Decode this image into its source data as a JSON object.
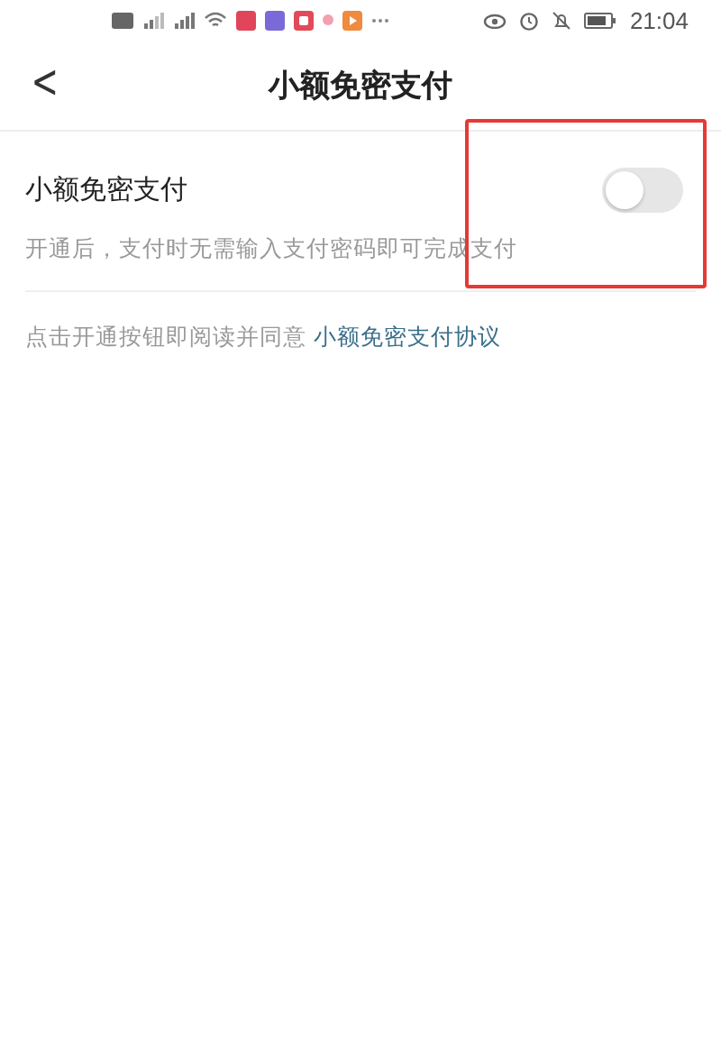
{
  "status_bar": {
    "time": "21:04"
  },
  "header": {
    "back_icon": "<",
    "title": "小额免密支付"
  },
  "setting": {
    "label": "小额免密支付",
    "on": false,
    "description": "开通后，支付时无需输入支付密码即可完成支付"
  },
  "agreement": {
    "text": "点击开通按钮即阅读并同意",
    "link": "小额免密支付协议"
  },
  "highlight": {
    "color": "#e53935"
  }
}
